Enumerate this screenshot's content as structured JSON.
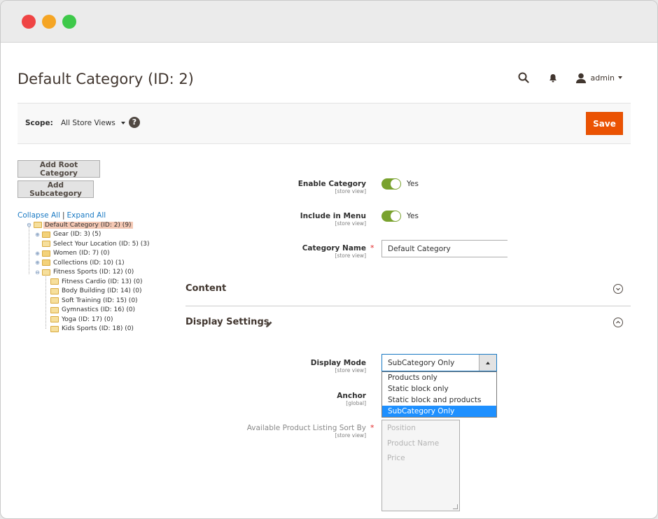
{
  "header": {
    "title": "Default Category (ID: 2)",
    "user_name": "admin"
  },
  "scope": {
    "label": "Scope:",
    "value": "All Store Views",
    "help": "?"
  },
  "actions": {
    "save_label": "Save",
    "add_root_label": "Add Root Category",
    "add_sub_label": "Add Subcategory"
  },
  "tree": {
    "collapse_all": "Collapse All",
    "separator": "|",
    "expand_all": "Expand All",
    "nodes": [
      {
        "label": "Default Category (ID: 2) (9)"
      },
      {
        "label": "Gear (ID: 3) (5)"
      },
      {
        "label": "Select Your Location (ID: 5) (3)"
      },
      {
        "label": "Women (ID: 7) (0)"
      },
      {
        "label": "Collections (ID: 10) (1)"
      },
      {
        "label": "Fitness Sports (ID: 12) (0)"
      },
      {
        "label": "Fitness Cardio (ID: 13) (0)"
      },
      {
        "label": "Body Building (ID: 14) (0)"
      },
      {
        "label": "Soft Training (ID: 15) (0)"
      },
      {
        "label": "Gymnastics (ID: 16) (0)"
      },
      {
        "label": "Yoga (ID: 17) (0)"
      },
      {
        "label": "Kids Sports (ID: 18) (0)"
      }
    ]
  },
  "form": {
    "enable_category": {
      "label": "Enable Category",
      "scope": "[store view]",
      "value": "Yes"
    },
    "include_in_menu": {
      "label": "Include in Menu",
      "scope": "[store view]",
      "value": "Yes"
    },
    "category_name": {
      "label": "Category Name",
      "scope": "[store view]",
      "value": "Default Category",
      "required": "*"
    }
  },
  "sections": {
    "content": "Content",
    "display_settings": "Display Settings"
  },
  "display": {
    "display_mode": {
      "label": "Display Mode",
      "scope": "[store view]",
      "value": "SubCategory Only"
    },
    "options": [
      "Products only",
      "Static block only",
      "Static block and products",
      "SubCategory Only"
    ],
    "anchor": {
      "label": "Anchor",
      "scope": "[global]"
    },
    "sort_by": {
      "label": "Available Product Listing Sort By",
      "scope": "[store view]",
      "required": "*",
      "options": [
        "Position",
        "Product Name",
        "Price"
      ]
    }
  },
  "colors": {
    "accent": "#eb5202",
    "toggle_on": "#79a22e",
    "link": "#1979c3",
    "selection": "#1e90ff"
  },
  "icons": [
    "search-icon",
    "bell-icon",
    "user-icon",
    "help-icon",
    "pencil-icon",
    "chevron-down-circle-icon",
    "chevron-up-circle-icon",
    "folder-icon"
  ]
}
